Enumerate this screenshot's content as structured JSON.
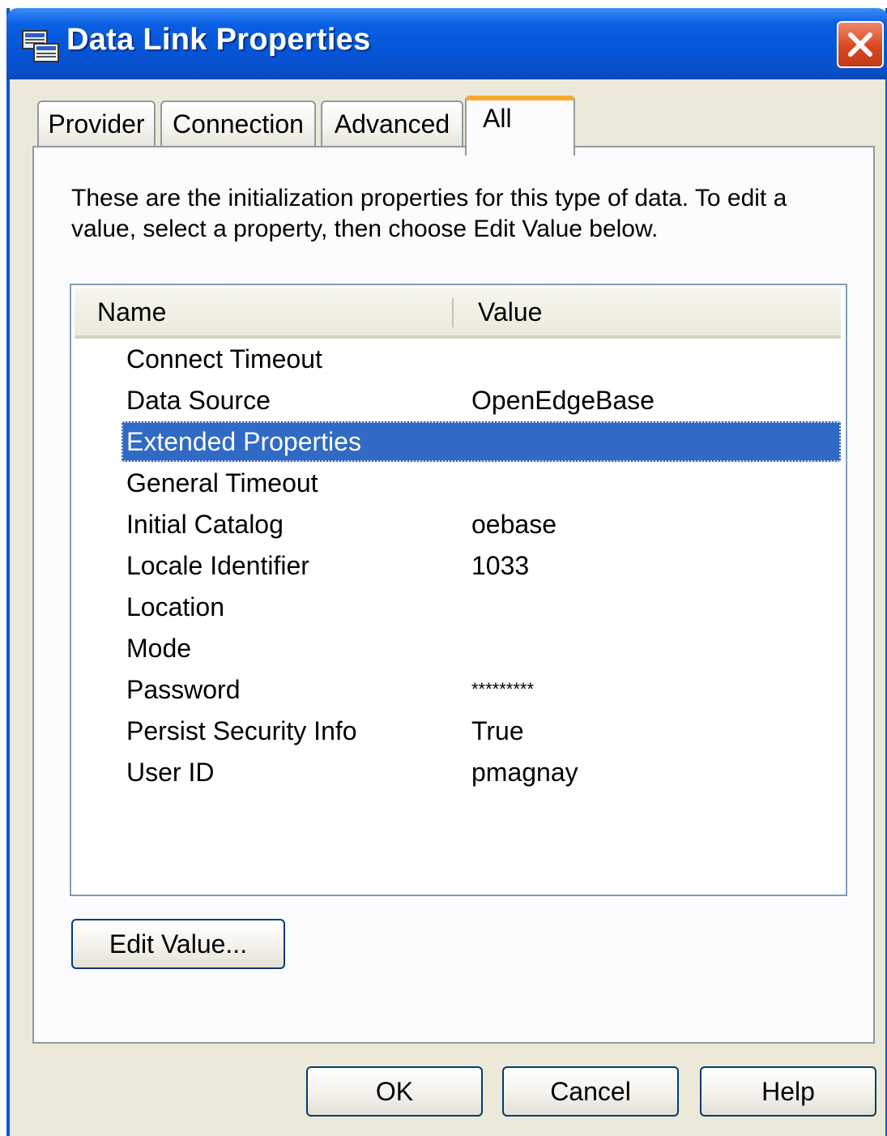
{
  "window": {
    "title": "Data Link Properties"
  },
  "tabs": [
    {
      "label": "Provider"
    },
    {
      "label": "Connection"
    },
    {
      "label": "Advanced"
    },
    {
      "label": "All",
      "active": true
    }
  ],
  "panel": {
    "description": "These are the initialization properties for this type of data. To edit a value, select a property, then choose Edit Value below."
  },
  "properties": {
    "columns": {
      "name": "Name",
      "value": "Value"
    },
    "rows": [
      {
        "name": "Connect Timeout",
        "value": ""
      },
      {
        "name": "Data Source",
        "value": "OpenEdgeBase"
      },
      {
        "name": "Extended Properties",
        "value": "",
        "selected": true
      },
      {
        "name": "General Timeout",
        "value": ""
      },
      {
        "name": "Initial Catalog",
        "value": "oebase"
      },
      {
        "name": "Locale Identifier",
        "value": "1033"
      },
      {
        "name": "Location",
        "value": ""
      },
      {
        "name": "Mode",
        "value": ""
      },
      {
        "name": "Password",
        "value": "*********"
      },
      {
        "name": "Persist Security Info",
        "value": "True"
      },
      {
        "name": "User ID",
        "value": "pmagnay"
      }
    ]
  },
  "buttons": {
    "edit_value": "Edit Value...",
    "ok": "OK",
    "cancel": "Cancel",
    "help": "Help"
  },
  "icons": {
    "app": "data-link-icon",
    "close": "close-icon"
  },
  "colors": {
    "titlebar": "#0555d8",
    "selection": "#316ac5",
    "active_tab_accent": "#f7a92c",
    "close_button": "#d9481f"
  }
}
